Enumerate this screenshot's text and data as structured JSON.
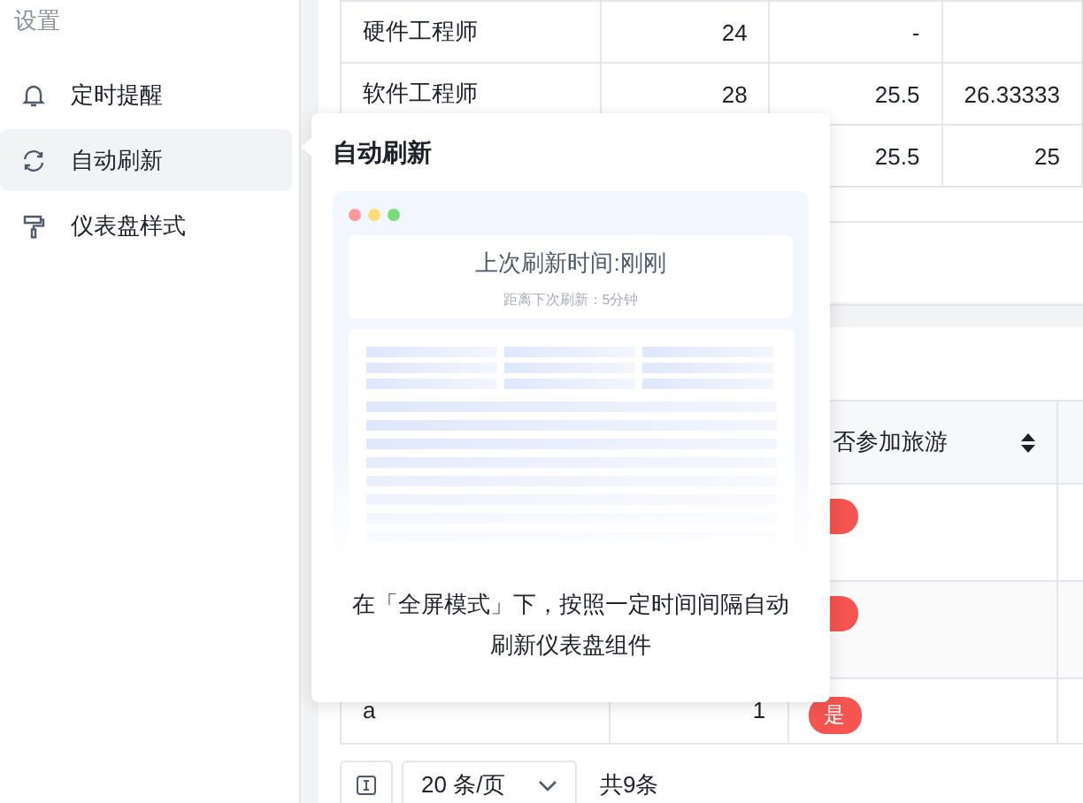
{
  "sidebar": {
    "heading": "设置",
    "items": [
      {
        "label": "定时提醒",
        "kind": "bell",
        "selected": false
      },
      {
        "label": "自动刷新",
        "kind": "refresh",
        "selected": true
      },
      {
        "label": "仪表盘样式",
        "kind": "roller",
        "selected": false
      }
    ]
  },
  "top_table": {
    "rows": [
      {
        "cells": [
          "硬件工程师",
          "24",
          "-",
          null
        ]
      },
      {
        "cells": [
          "软件工程师",
          "28",
          "25.5",
          "26.33333"
        ]
      },
      {
        "cells": [
          null,
          null,
          "25.5",
          "25"
        ]
      }
    ]
  },
  "bottom_table": {
    "columns": [
      {
        "label": "否参加旅游",
        "sortable": true
      }
    ],
    "rows": [
      {
        "tagged": true
      },
      {
        "tagged": true
      },
      {
        "cells": [
          "a",
          "1"
        ],
        "tagged": true,
        "tag_label": "是"
      }
    ]
  },
  "pagination": {
    "page_size": "20 条/页",
    "total": "共9条"
  },
  "popover": {
    "title": "自动刷新",
    "preview_title": "上次刷新时间:刚刚",
    "preview_subtitle": "距离下次刷新：5分钟",
    "description": "在「全屏模式」下，按照一定时间间隔自动刷新仪表盘组件"
  }
}
